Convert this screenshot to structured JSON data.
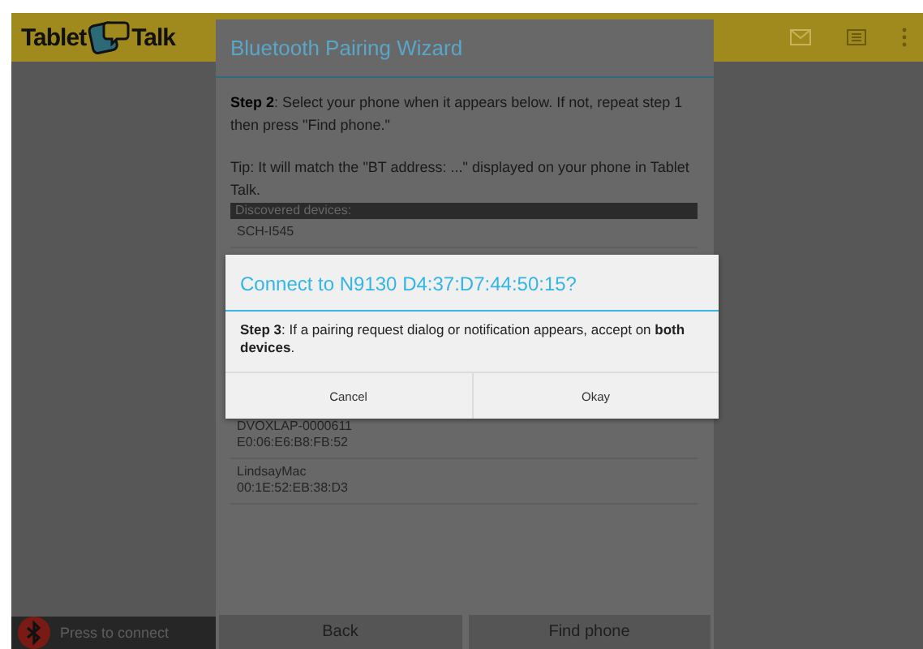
{
  "app_bar": {
    "logo": [
      "Tablet",
      "Talk"
    ]
  },
  "connect_bar": {
    "label": "Press to connect"
  },
  "wizard": {
    "title": "Bluetooth Pairing Wizard",
    "step": "**Step 2**: Select your phone when it appears below. If not, repeat step 1 then press \"Find phone.\"",
    "tip": "Tip: It will match the \"BT address: ...\" displayed on your phone in Tablet Talk.",
    "devices_header": "Discovered devices:",
    "devices": [
      {
        "name": "SCH-I545"
      },
      {
        "name": "DVOXLAP-0000611",
        "address": "E0:06:E6:B8:FB:52"
      },
      {
        "name": "LindsayMac",
        "address": "00:1E:52:EB:38:D3"
      }
    ],
    "buttons": [
      "Back",
      "Find phone"
    ]
  },
  "confirm": {
    "title": "Connect to N9130 D4:37:D7:44:50:15?",
    "body": "**Step 3**: If a pairing request dialog or notification appears, accept on **both devices**.",
    "buttons": [
      "Cancel",
      "Okay"
    ]
  }
}
